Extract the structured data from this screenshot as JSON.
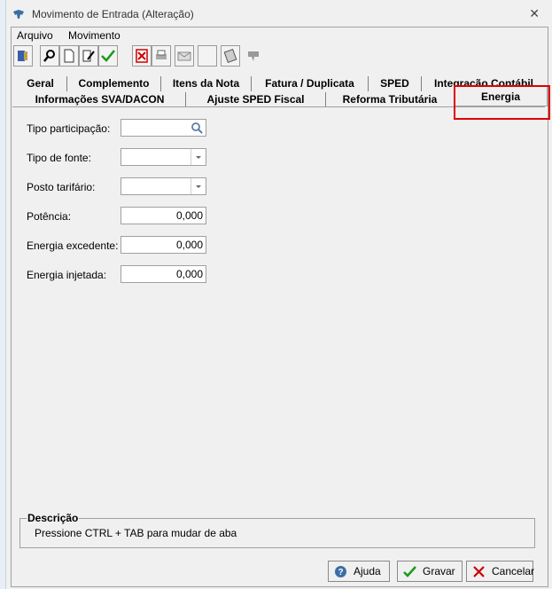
{
  "window": {
    "title": "Movimento de Entrada (Alteração)",
    "close_glyph": "✕"
  },
  "menu": {
    "items": [
      "Arquivo",
      "Movimento"
    ]
  },
  "toolbar": {
    "buttons": [
      "exit-icon",
      "search-icon",
      "new-doc-icon",
      "edit-icon",
      "confirm-icon",
      "delete-icon",
      "print-icon",
      "mail-icon",
      "blank",
      "calculator-icon",
      "arrow-icon"
    ]
  },
  "tabs": {
    "row1": [
      "Geral",
      "Complemento",
      "Itens da Nota",
      "Fatura / Duplicata",
      "SPED",
      "Integração Contábil"
    ],
    "row2": [
      "Informações SVA/DACON",
      "Ajuste SPED Fiscal",
      "Reforma Tributária"
    ],
    "active": "Energia"
  },
  "form": {
    "tipo_participacao": {
      "label": "Tipo participação:",
      "value": ""
    },
    "tipo_fonte": {
      "label": "Tipo de fonte:",
      "value": ""
    },
    "posto_tarifario": {
      "label": "Posto tarifário:",
      "value": ""
    },
    "potencia": {
      "label": "Potência:",
      "value": "0,000"
    },
    "energia_excedente": {
      "label": "Energia excedente:",
      "value": "0,000"
    },
    "energia_injetada": {
      "label": "Energia injetada:",
      "value": "0,000"
    }
  },
  "description": {
    "title": "Descrição",
    "text": "Pressione CTRL + TAB para  mudar de aba"
  },
  "buttons": {
    "help": "Ajuda",
    "save": "Gravar",
    "cancel": "Cancelar"
  },
  "colors": {
    "highlight": "#e00000",
    "accent_green": "#1a9a1a",
    "cancel_red": "#cc0000"
  }
}
